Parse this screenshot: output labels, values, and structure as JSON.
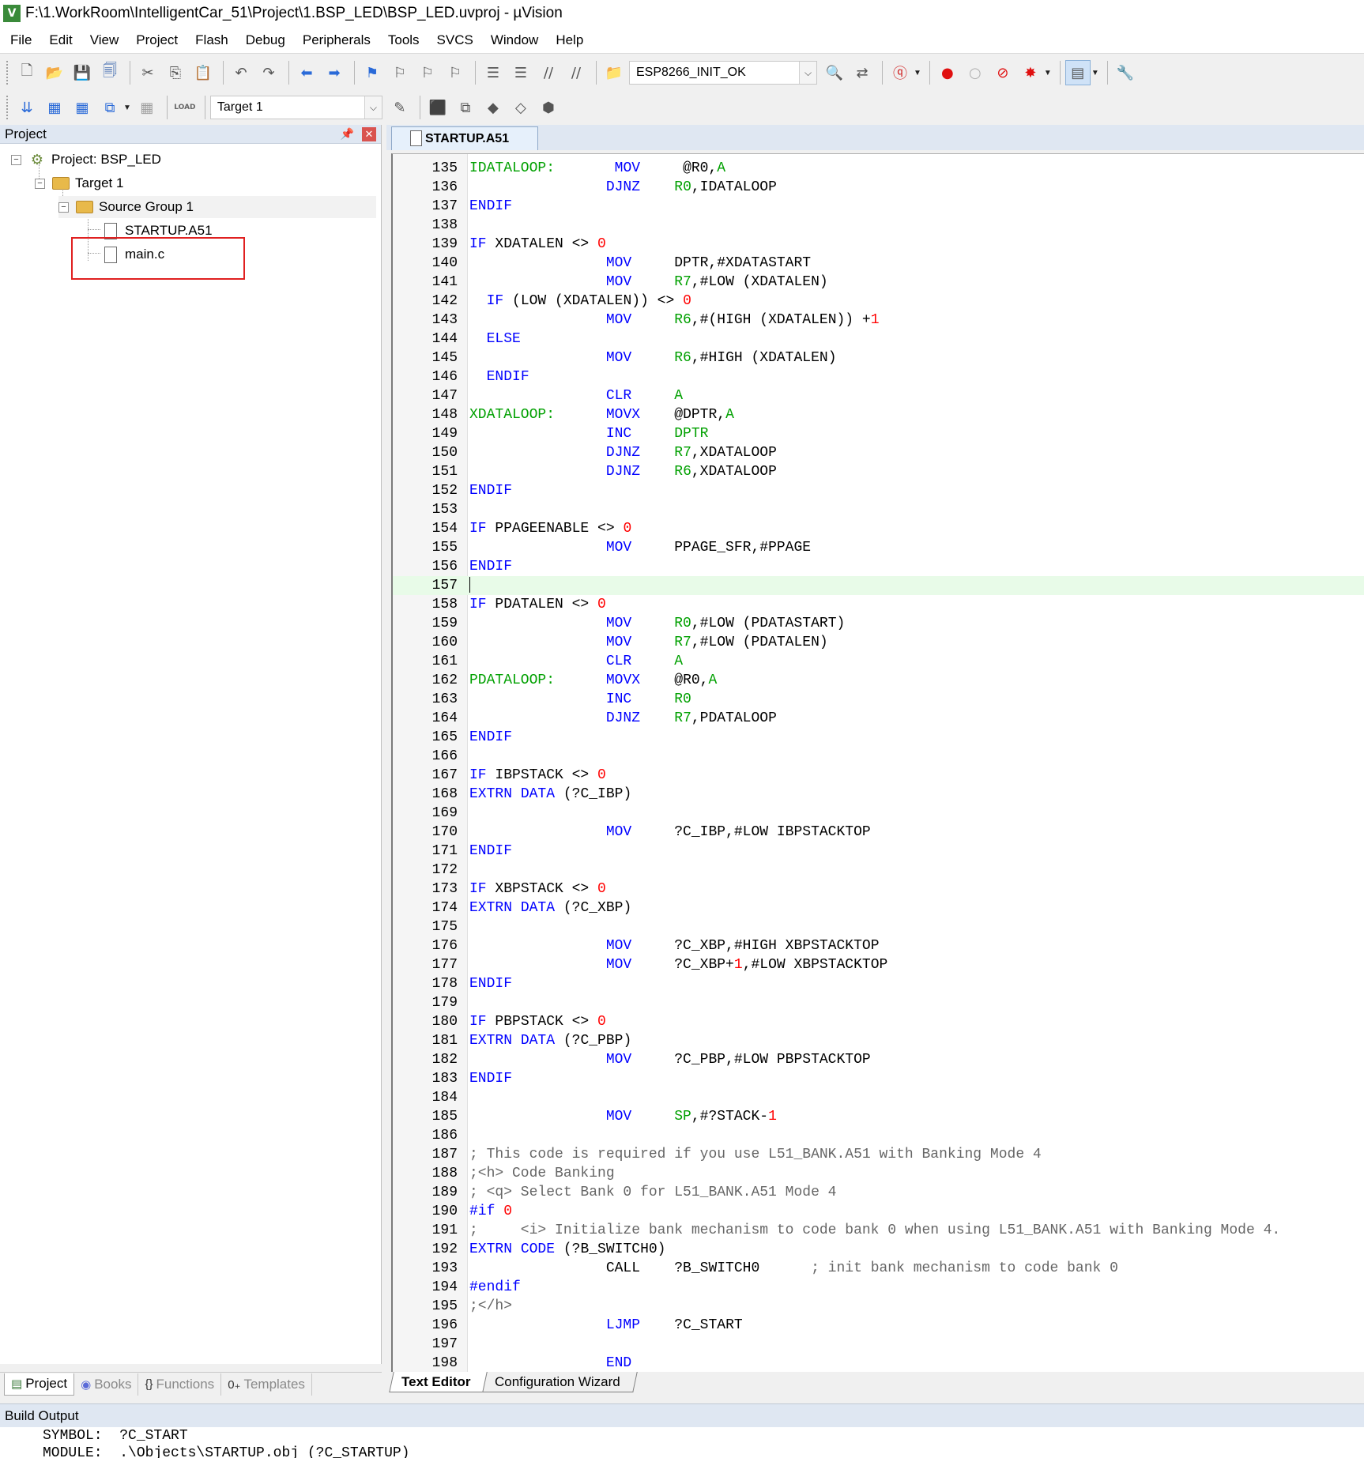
{
  "window": {
    "title": "F:\\1.WorkRoom\\IntelligentCar_51\\Project\\1.BSP_LED\\BSP_LED.uvproj - µVision",
    "icon_text": "V"
  },
  "menu": [
    "File",
    "Edit",
    "View",
    "Project",
    "Flash",
    "Debug",
    "Peripherals",
    "Tools",
    "SVCS",
    "Window",
    "Help"
  ],
  "toolbar1": {
    "find_combo_value": "ESP8266_INIT_OK"
  },
  "toolbar2": {
    "target_combo_value": "Target 1",
    "load_label": "LOAD"
  },
  "project_panel": {
    "title": "Project",
    "tree": {
      "project": "Project: BSP_LED",
      "target": "Target 1",
      "group": "Source Group 1",
      "files": [
        "STARTUP.A51",
        "main.c"
      ]
    },
    "tabs": [
      "Project",
      "Books",
      "Functions",
      "Templates"
    ]
  },
  "editor": {
    "active_tab": "STARTUP.A51",
    "current_line": 157,
    "lines": [
      {
        "n": 135,
        "segs": [
          [
            "lbl",
            "IDATALOOP:"
          ],
          [
            "",
            "       "
          ],
          [
            "kw",
            "MOV"
          ],
          [
            "",
            "     "
          ],
          [
            "",
            "@R0,"
          ],
          [
            "lbl",
            "A"
          ]
        ]
      },
      {
        "n": 136,
        "segs": [
          [
            "",
            "                "
          ],
          [
            "kw",
            "DJNZ"
          ],
          [
            "",
            "    "
          ],
          [
            "lbl",
            "R0"
          ],
          [
            "",
            ",IDATALOOP"
          ]
        ]
      },
      {
        "n": 137,
        "segs": [
          [
            "kw",
            "ENDIF"
          ]
        ]
      },
      {
        "n": 138,
        "segs": []
      },
      {
        "n": 139,
        "segs": [
          [
            "kw",
            "IF"
          ],
          [
            "",
            " XDATALEN <> "
          ],
          [
            "num",
            "0"
          ]
        ]
      },
      {
        "n": 140,
        "segs": [
          [
            "",
            "                "
          ],
          [
            "kw",
            "MOV"
          ],
          [
            "",
            "     "
          ],
          [
            "",
            "DPTR,#XDATASTART"
          ]
        ]
      },
      {
        "n": 141,
        "segs": [
          [
            "",
            "                "
          ],
          [
            "kw",
            "MOV"
          ],
          [
            "",
            "     "
          ],
          [
            "lbl",
            "R7"
          ],
          [
            "",
            ",#LOW (XDATALEN)"
          ]
        ]
      },
      {
        "n": 142,
        "segs": [
          [
            "",
            "  "
          ],
          [
            "kw",
            "IF"
          ],
          [
            "",
            " (LOW (XDATALEN)) <> "
          ],
          [
            "num",
            "0"
          ]
        ]
      },
      {
        "n": 143,
        "segs": [
          [
            "",
            "                "
          ],
          [
            "kw",
            "MOV"
          ],
          [
            "",
            "     "
          ],
          [
            "lbl",
            "R6"
          ],
          [
            "",
            ",#(HIGH (XDATALEN)) +"
          ],
          [
            "num",
            "1"
          ]
        ]
      },
      {
        "n": 144,
        "segs": [
          [
            "",
            "  "
          ],
          [
            "kw",
            "ELSE"
          ]
        ]
      },
      {
        "n": 145,
        "segs": [
          [
            "",
            "                "
          ],
          [
            "kw",
            "MOV"
          ],
          [
            "",
            "     "
          ],
          [
            "lbl",
            "R6"
          ],
          [
            "",
            ",#HIGH (XDATALEN)"
          ]
        ]
      },
      {
        "n": 146,
        "segs": [
          [
            "",
            "  "
          ],
          [
            "kw",
            "ENDIF"
          ]
        ]
      },
      {
        "n": 147,
        "segs": [
          [
            "",
            "                "
          ],
          [
            "kw",
            "CLR"
          ],
          [
            "",
            "     "
          ],
          [
            "lbl",
            "A"
          ]
        ]
      },
      {
        "n": 148,
        "segs": [
          [
            "lbl",
            "XDATALOOP:"
          ],
          [
            "",
            "      "
          ],
          [
            "kw",
            "MOVX"
          ],
          [
            "",
            "    "
          ],
          [
            "",
            "@DPTR,"
          ],
          [
            "lbl",
            "A"
          ]
        ]
      },
      {
        "n": 149,
        "segs": [
          [
            "",
            "                "
          ],
          [
            "kw",
            "INC"
          ],
          [
            "",
            "     "
          ],
          [
            "lbl",
            "DPTR"
          ]
        ]
      },
      {
        "n": 150,
        "segs": [
          [
            "",
            "                "
          ],
          [
            "kw",
            "DJNZ"
          ],
          [
            "",
            "    "
          ],
          [
            "lbl",
            "R7"
          ],
          [
            "",
            ",XDATALOOP"
          ]
        ]
      },
      {
        "n": 151,
        "segs": [
          [
            "",
            "                "
          ],
          [
            "kw",
            "DJNZ"
          ],
          [
            "",
            "    "
          ],
          [
            "lbl",
            "R6"
          ],
          [
            "",
            ",XDATALOOP"
          ]
        ]
      },
      {
        "n": 152,
        "segs": [
          [
            "kw",
            "ENDIF"
          ]
        ]
      },
      {
        "n": 153,
        "segs": []
      },
      {
        "n": 154,
        "segs": [
          [
            "kw",
            "IF"
          ],
          [
            "",
            " PPAGEENABLE <> "
          ],
          [
            "num",
            "0"
          ]
        ]
      },
      {
        "n": 155,
        "segs": [
          [
            "",
            "                "
          ],
          [
            "kw",
            "MOV"
          ],
          [
            "",
            "     "
          ],
          [
            "",
            "PPAGE_SFR,#PPAGE"
          ]
        ]
      },
      {
        "n": 156,
        "segs": [
          [
            "kw",
            "ENDIF"
          ]
        ]
      },
      {
        "n": 157,
        "segs": []
      },
      {
        "n": 158,
        "segs": [
          [
            "kw",
            "IF"
          ],
          [
            "",
            " PDATALEN <> "
          ],
          [
            "num",
            "0"
          ]
        ]
      },
      {
        "n": 159,
        "segs": [
          [
            "",
            "                "
          ],
          [
            "kw",
            "MOV"
          ],
          [
            "",
            "     "
          ],
          [
            "lbl",
            "R0"
          ],
          [
            "",
            ",#LOW (PDATASTART)"
          ]
        ]
      },
      {
        "n": 160,
        "segs": [
          [
            "",
            "                "
          ],
          [
            "kw",
            "MOV"
          ],
          [
            "",
            "     "
          ],
          [
            "lbl",
            "R7"
          ],
          [
            "",
            ",#LOW (PDATALEN)"
          ]
        ]
      },
      {
        "n": 161,
        "segs": [
          [
            "",
            "                "
          ],
          [
            "kw",
            "CLR"
          ],
          [
            "",
            "     "
          ],
          [
            "lbl",
            "A"
          ]
        ]
      },
      {
        "n": 162,
        "segs": [
          [
            "lbl",
            "PDATALOOP:"
          ],
          [
            "",
            "      "
          ],
          [
            "kw",
            "MOVX"
          ],
          [
            "",
            "    "
          ],
          [
            "",
            "@R0,"
          ],
          [
            "lbl",
            "A"
          ]
        ]
      },
      {
        "n": 163,
        "segs": [
          [
            "",
            "                "
          ],
          [
            "kw",
            "INC"
          ],
          [
            "",
            "     "
          ],
          [
            "lbl",
            "R0"
          ]
        ]
      },
      {
        "n": 164,
        "segs": [
          [
            "",
            "                "
          ],
          [
            "kw",
            "DJNZ"
          ],
          [
            "",
            "    "
          ],
          [
            "lbl",
            "R7"
          ],
          [
            "",
            ",PDATALOOP"
          ]
        ]
      },
      {
        "n": 165,
        "segs": [
          [
            "kw",
            "ENDIF"
          ]
        ]
      },
      {
        "n": 166,
        "segs": []
      },
      {
        "n": 167,
        "segs": [
          [
            "kw",
            "IF"
          ],
          [
            "",
            " IBPSTACK <> "
          ],
          [
            "num",
            "0"
          ]
        ]
      },
      {
        "n": 168,
        "segs": [
          [
            "kw",
            "EXTRN"
          ],
          [
            "",
            " "
          ],
          [
            "kw",
            "DATA"
          ],
          [
            "",
            " (?C_IBP)"
          ]
        ]
      },
      {
        "n": 169,
        "segs": []
      },
      {
        "n": 170,
        "segs": [
          [
            "",
            "                "
          ],
          [
            "kw",
            "MOV"
          ],
          [
            "",
            "     "
          ],
          [
            "",
            "?C_IBP,#LOW IBPSTACKTOP"
          ]
        ]
      },
      {
        "n": 171,
        "segs": [
          [
            "kw",
            "ENDIF"
          ]
        ]
      },
      {
        "n": 172,
        "segs": []
      },
      {
        "n": 173,
        "segs": [
          [
            "kw",
            "IF"
          ],
          [
            "",
            " XBPSTACK <> "
          ],
          [
            "num",
            "0"
          ]
        ]
      },
      {
        "n": 174,
        "segs": [
          [
            "kw",
            "EXTRN"
          ],
          [
            "",
            " "
          ],
          [
            "kw",
            "DATA"
          ],
          [
            "",
            " (?C_XBP)"
          ]
        ]
      },
      {
        "n": 175,
        "segs": []
      },
      {
        "n": 176,
        "segs": [
          [
            "",
            "                "
          ],
          [
            "kw",
            "MOV"
          ],
          [
            "",
            "     "
          ],
          [
            "",
            "?C_XBP,#HIGH XBPSTACKTOP"
          ]
        ]
      },
      {
        "n": 177,
        "segs": [
          [
            "",
            "                "
          ],
          [
            "kw",
            "MOV"
          ],
          [
            "",
            "     "
          ],
          [
            "",
            "?C_XBP+"
          ],
          [
            "num",
            "1"
          ],
          [
            "",
            ",#LOW XBPSTACKTOP"
          ]
        ]
      },
      {
        "n": 178,
        "segs": [
          [
            "kw",
            "ENDIF"
          ]
        ]
      },
      {
        "n": 179,
        "segs": []
      },
      {
        "n": 180,
        "segs": [
          [
            "kw",
            "IF"
          ],
          [
            "",
            " PBPSTACK <> "
          ],
          [
            "num",
            "0"
          ]
        ]
      },
      {
        "n": 181,
        "segs": [
          [
            "kw",
            "EXTRN"
          ],
          [
            "",
            " "
          ],
          [
            "kw",
            "DATA"
          ],
          [
            "",
            " (?C_PBP)"
          ]
        ]
      },
      {
        "n": 182,
        "segs": [
          [
            "",
            "                "
          ],
          [
            "kw",
            "MOV"
          ],
          [
            "",
            "     "
          ],
          [
            "",
            "?C_PBP,#LOW PBPSTACKTOP"
          ]
        ]
      },
      {
        "n": 183,
        "segs": [
          [
            "kw",
            "ENDIF"
          ]
        ]
      },
      {
        "n": 184,
        "segs": []
      },
      {
        "n": 185,
        "segs": [
          [
            "",
            "                "
          ],
          [
            "kw",
            "MOV"
          ],
          [
            "",
            "     "
          ],
          [
            "lbl",
            "SP"
          ],
          [
            "",
            ",#?STACK-"
          ],
          [
            "num",
            "1"
          ]
        ]
      },
      {
        "n": 186,
        "segs": []
      },
      {
        "n": 187,
        "segs": [
          [
            "cmt",
            "; This code is required if you use L51_BANK.A51 with Banking Mode 4"
          ]
        ]
      },
      {
        "n": 188,
        "segs": [
          [
            "cmt",
            ";<h> Code Banking"
          ]
        ]
      },
      {
        "n": 189,
        "segs": [
          [
            "cmt",
            "; <q> Select Bank 0 for L51_BANK.A51 Mode 4"
          ]
        ]
      },
      {
        "n": 190,
        "segs": [
          [
            "kw",
            "#if"
          ],
          [
            "",
            " "
          ],
          [
            "num",
            "0"
          ]
        ]
      },
      {
        "n": 191,
        "segs": [
          [
            "cmt",
            ";     <i> Initialize bank mechanism to code bank 0 when using L51_BANK.A51 with Banking Mode 4."
          ]
        ]
      },
      {
        "n": 192,
        "segs": [
          [
            "kw",
            "EXTRN"
          ],
          [
            "",
            " "
          ],
          [
            "kw",
            "CODE"
          ],
          [
            "",
            " (?B_SWITCH0)"
          ]
        ]
      },
      {
        "n": 193,
        "segs": [
          [
            "",
            "                CALL    ?B_SWITCH0      "
          ],
          [
            "cmt",
            "; init bank mechanism to code bank 0"
          ]
        ]
      },
      {
        "n": 194,
        "segs": [
          [
            "kw",
            "#endif"
          ]
        ]
      },
      {
        "n": 195,
        "segs": [
          [
            "cmt",
            ";</h>"
          ]
        ]
      },
      {
        "n": 196,
        "segs": [
          [
            "",
            "                "
          ],
          [
            "kw",
            "LJMP"
          ],
          [
            "",
            "    "
          ],
          [
            "",
            "?C_START"
          ]
        ]
      },
      {
        "n": 197,
        "segs": []
      },
      {
        "n": 198,
        "segs": [
          [
            "",
            "                "
          ],
          [
            "kw",
            "END"
          ]
        ]
      }
    ],
    "bottom_tabs": [
      "Text Editor",
      "Configuration Wizard"
    ]
  },
  "build_output": {
    "title": "Build Output",
    "lines": [
      "SYMBOL:  ?C_START",
      "MODULE:  .\\Objects\\STARTUP.obj (?C_STARTUP)"
    ]
  }
}
